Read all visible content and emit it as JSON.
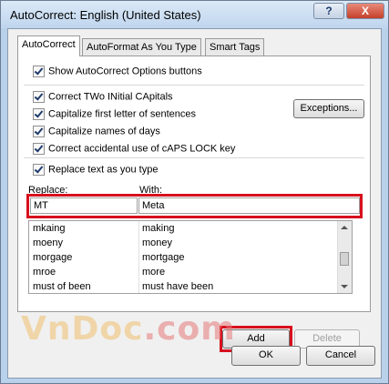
{
  "window": {
    "title": "AutoCorrect: English (United States)"
  },
  "titlebar": {
    "help_label": "?",
    "close_label": "X"
  },
  "tabs": [
    {
      "label": "AutoCorrect",
      "active": true
    },
    {
      "label": "AutoFormat As You Type",
      "active": false
    },
    {
      "label": "Smart Tags",
      "active": false
    }
  ],
  "options": {
    "show_buttons": {
      "label": "Show AutoCorrect Options buttons",
      "checked": true
    },
    "two_initial_caps": {
      "label": "Correct TWo INitial CApitals",
      "checked": true
    },
    "capitalize_sentences": {
      "label": "Capitalize first letter of sentences",
      "checked": true
    },
    "capitalize_days": {
      "label": "Capitalize names of days",
      "checked": true
    },
    "caps_lock": {
      "label": "Correct accidental use of cAPS LOCK key",
      "checked": true
    },
    "replace_text": {
      "label": "Replace text as you type",
      "checked": true
    }
  },
  "exceptions_label": "Exceptions...",
  "replace": {
    "replace_label": "Replace:",
    "with_label": "With:",
    "replace_value": "MT",
    "with_value": "Meta"
  },
  "entries": [
    {
      "replace": "mkaing",
      "with": "making"
    },
    {
      "replace": "moeny",
      "with": "money"
    },
    {
      "replace": "morgage",
      "with": "mortgage"
    },
    {
      "replace": "mroe",
      "with": "more"
    },
    {
      "replace": "must of been",
      "with": "must have been"
    }
  ],
  "buttons": {
    "add": "Add",
    "delete": "Delete",
    "ok": "OK",
    "cancel": "Cancel"
  },
  "watermark": {
    "text_a": "VnDoc",
    "text_b": ".com"
  },
  "colors": {
    "highlight": "#d8101d",
    "titlebar": "#bfd5ee",
    "close": "#c4402a"
  }
}
